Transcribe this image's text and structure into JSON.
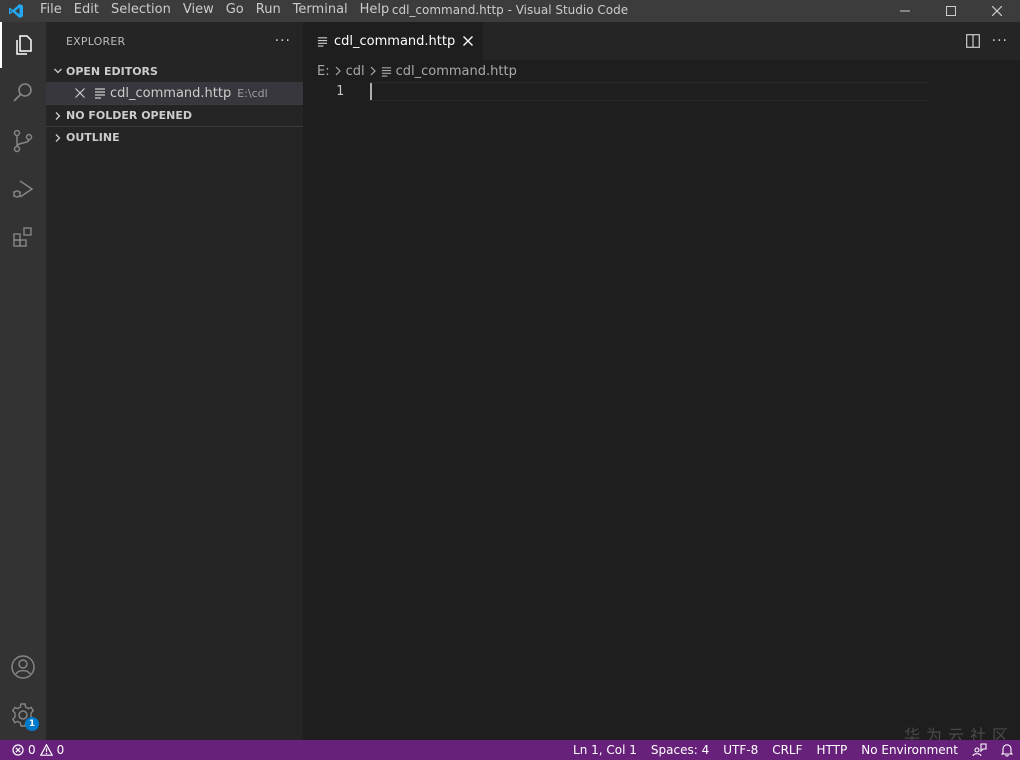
{
  "window": {
    "title": "cdl_command.http - Visual Studio Code"
  },
  "menu": [
    "File",
    "Edit",
    "Selection",
    "View",
    "Go",
    "Run",
    "Terminal",
    "Help"
  ],
  "activity_bar": {
    "items": [
      "explorer-icon",
      "search-icon",
      "source-control-icon",
      "run-debug-icon",
      "extensions-icon"
    ],
    "bottom": [
      "accounts-icon",
      "settings-gear-icon"
    ],
    "settings_badge": "1"
  },
  "sidebar": {
    "title": "EXPLORER",
    "more": "···",
    "sections": {
      "open_editors": "OPEN EDITORS",
      "no_folder": "NO FOLDER OPENED",
      "outline": "OUTLINE"
    },
    "open_editor": {
      "name": "cdl_command.http",
      "path": "E:\\cdl"
    }
  },
  "editor": {
    "tab_label": "cdl_command.http",
    "breadcrumb": [
      "E:",
      "cdl",
      "cdl_command.http"
    ],
    "line_number": "1",
    "more": "···"
  },
  "watermark": "华为云社区",
  "statusbar": {
    "errors": "0",
    "warnings": "0",
    "position": "Ln 1, Col 1",
    "spaces": "Spaces: 4",
    "encoding": "UTF-8",
    "eol": "CRLF",
    "language": "HTTP",
    "environment": "No Environment"
  },
  "colors": {
    "statusbar": "#68217a",
    "activitybar": "#333333",
    "sidebar": "#252526",
    "editor": "#1e1e1e",
    "titlebar": "#3c3c3c",
    "badge": "#007acc"
  }
}
